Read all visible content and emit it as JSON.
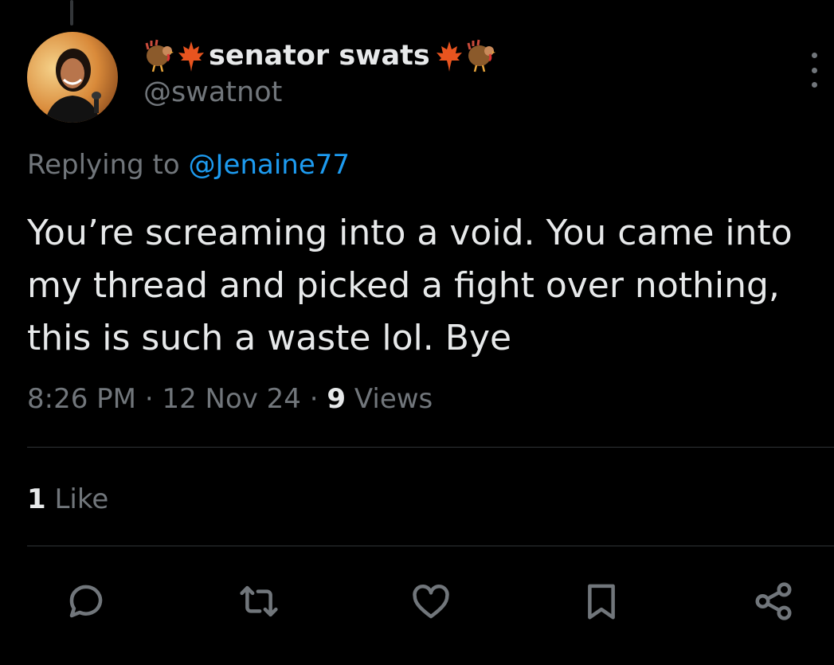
{
  "tweet": {
    "author": {
      "display_name": "senator swats",
      "handle": "@swatnot",
      "name_emojis": [
        "turkey-emoji",
        "maple-leaf-emoji",
        "maple-leaf-emoji",
        "turkey-emoji"
      ]
    },
    "reply": {
      "prefix": "Replying to",
      "target": "@Jenaine77"
    },
    "text": "You’re screaming into a void. You came into my thread and picked a fight over nothing, this is such a waste lol. Bye",
    "meta": {
      "time": "8:26 PM",
      "separator": "·",
      "date": "12 Nov 24",
      "views_count": "9",
      "views_label": "Views"
    },
    "engagement": {
      "likes_count": "1",
      "likes_label": "Like"
    },
    "actions": [
      "reply-icon",
      "retweet-icon",
      "like-icon",
      "bookmark-icon",
      "share-icon"
    ]
  },
  "colors": {
    "background": "#000000",
    "primary_text": "#e7e9ea",
    "secondary_text": "#71767b",
    "link": "#1d9bf0",
    "divider": "#2f3336"
  }
}
